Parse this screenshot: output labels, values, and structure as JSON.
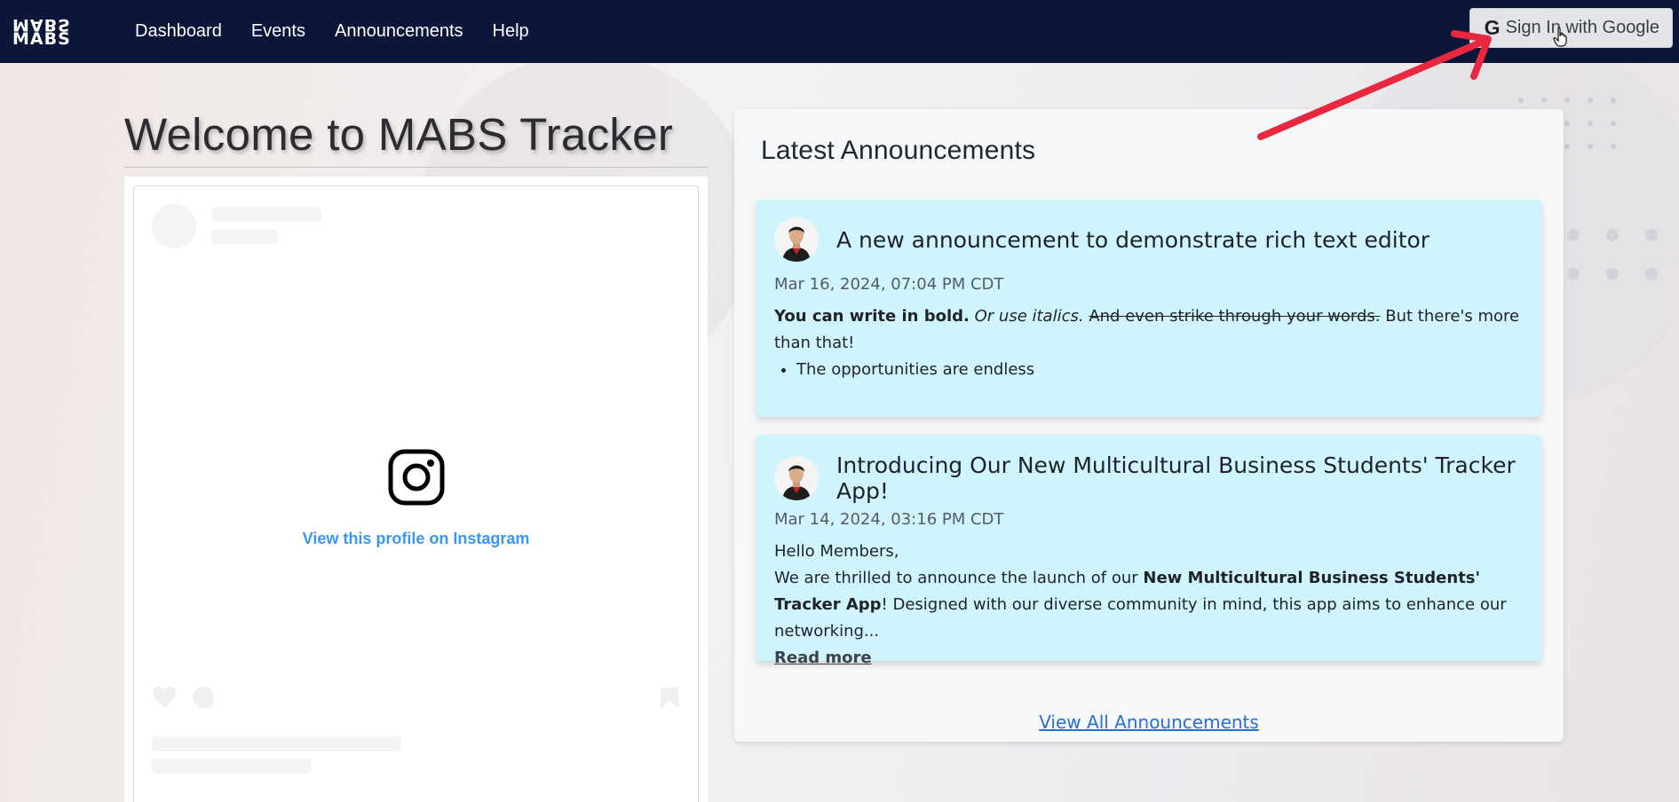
{
  "navbar": {
    "logo_top": "MABS",
    "logo_bottom": "MABS",
    "links": [
      "Dashboard",
      "Events",
      "Announcements",
      "Help"
    ],
    "signin_label": "Sign In with Google",
    "signin_icon": "G"
  },
  "welcome": {
    "title": "Welcome to MABS Tracker"
  },
  "instagram": {
    "link_text": "View this profile on Instagram"
  },
  "announcements": {
    "heading": "Latest Announcements",
    "items": [
      {
        "title": "A new announcement to demonstrate rich text editor",
        "date": "Mar 16, 2024, 07:04 PM CDT",
        "bold": "You can write in bold.",
        "italic": "Or use italics.",
        "strike": "And even strike through your words.",
        "tail": "But there's more than that!",
        "bullet": "The opportunities are endless"
      },
      {
        "title": "Introducing Our New Multicultural Business Students' Tracker App!",
        "date": "Mar 14, 2024, 03:16 PM CDT",
        "greeting": "Hello Members,",
        "intro": "We are thrilled to announce the launch of our",
        "app_name": "New Multicultural Business Students' Tracker App",
        "rest": "! Designed with our diverse community in mind, this app aims to enhance our networking...",
        "read_more": "Read more"
      }
    ],
    "view_all": "View All Announcements"
  },
  "colors": {
    "navbar": "#0b1638",
    "card": "#cff4fc",
    "link": "#2a6fd6",
    "instagram_link": "#3897f0",
    "annotation_arrow": "#e8283f"
  }
}
